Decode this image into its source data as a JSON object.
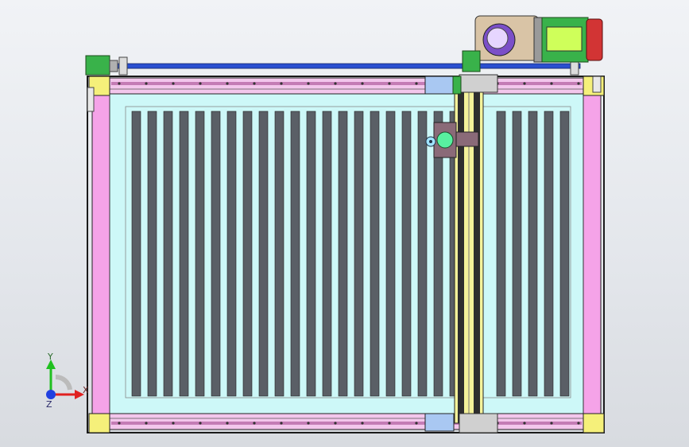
{
  "app": {
    "title": ""
  },
  "viewport": {
    "view": "Top",
    "background": "#e6e9ee"
  },
  "model": {
    "name": "",
    "colors": {
      "frame_outline": "#1a1a1a",
      "frame_side": "#f5a3e8",
      "corner_block": "#f5f07a",
      "bed_fill": "#cdf8f8",
      "slat": "#5a5f66",
      "rail_track": "#f3c7ec",
      "rail_slot": "#c47cb5",
      "gantry_beam": "#2e2e2e",
      "gantry_guide": "#f4f29a",
      "carriage_blue": "#a9c8f2",
      "motor_green": "#39b24a",
      "motor_red": "#d23434",
      "motor_lime": "#cfff5a",
      "reducer_tan": "#d9c4a6",
      "reducer_purple": "#7b4fc8",
      "drive_shaft": "#2a4fd0",
      "head_green": "#58f0a0",
      "head_plate": "#8a6a78"
    },
    "slats": {
      "count_left": 21,
      "count_right": 5
    },
    "parts": [
      "frame",
      "bed",
      "slats",
      "rail-top",
      "rail-bottom",
      "gantry",
      "carriage",
      "laser-head",
      "drive-shaft",
      "servo-motor-left",
      "gearbox-motor",
      "corner-blocks"
    ]
  },
  "triad": {
    "x_label": "X",
    "y_label": "Y",
    "z_label": "Z",
    "x_color": "#e02020",
    "y_color": "#20c020",
    "z_color": "#2040e0"
  }
}
